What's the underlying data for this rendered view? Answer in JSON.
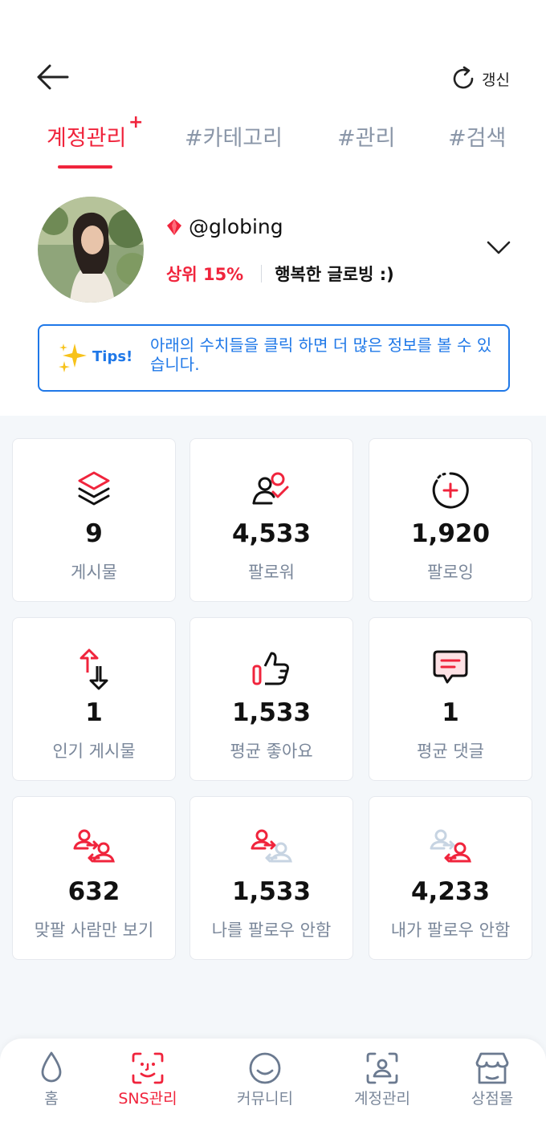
{
  "header": {
    "refresh_label": "갱신"
  },
  "tabs": [
    {
      "label": "계정관리",
      "plus": "+"
    },
    {
      "label": "#카테고리"
    },
    {
      "label": "#관리"
    },
    {
      "label": "#검색"
    }
  ],
  "profile": {
    "handle": "@globing",
    "rank": "상위 15%",
    "status": "행복한 글로빙 :)"
  },
  "tips": {
    "label": "Tips!",
    "text": "아래의 수치들을 클릭 하면 더 많은 정보를 볼 수 있습니다."
  },
  "stats": [
    {
      "value": "9",
      "label": "게시물",
      "icon": "layers-icon"
    },
    {
      "value": "4,533",
      "label": "팔로워",
      "icon": "followers-icon"
    },
    {
      "value": "1,920",
      "label": "팔로잉",
      "icon": "following-icon"
    },
    {
      "value": "1",
      "label": "인기 게시물",
      "icon": "up-down-arrows-icon"
    },
    {
      "value": "1,533",
      "label": "평균 좋아요",
      "icon": "thumbs-up-icon"
    },
    {
      "value": "1",
      "label": "평균 댓글",
      "icon": "comment-icon"
    },
    {
      "value": "632",
      "label": "맞팔 사람만 보기",
      "icon": "mutual-follow-icon"
    },
    {
      "value": "1,533",
      "label": "나를 팔로우 안함",
      "icon": "not-following-me-icon"
    },
    {
      "value": "4,233",
      "label": "내가 팔로우 안함",
      "icon": "i-dont-follow-icon"
    }
  ],
  "bottom_nav": [
    {
      "label": "홈",
      "icon": "drop-icon"
    },
    {
      "label": "SNS관리",
      "icon": "face-scan-icon",
      "active": true
    },
    {
      "label": "커뮤니티",
      "icon": "smile-icon"
    },
    {
      "label": "계정관리",
      "icon": "user-scan-icon"
    },
    {
      "label": "상점몰",
      "icon": "shop-icon"
    }
  ],
  "colors": {
    "accent": "#f0243c",
    "tips": "#1f78e8",
    "muted": "#7a879a"
  }
}
